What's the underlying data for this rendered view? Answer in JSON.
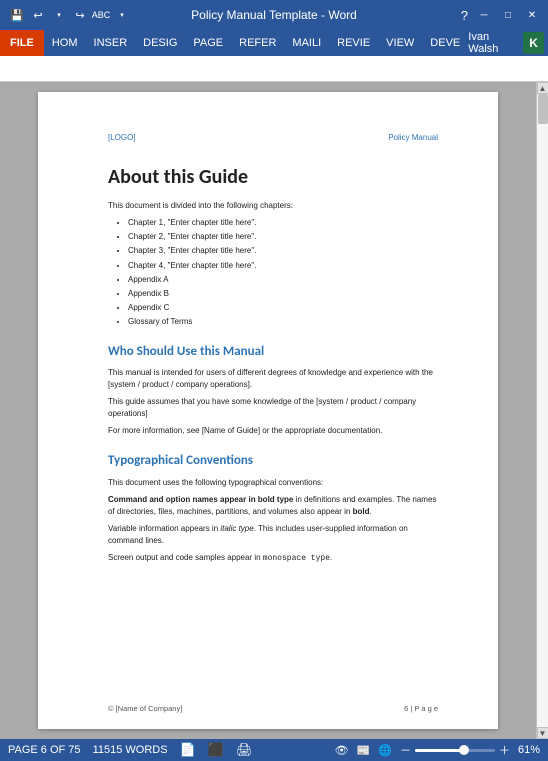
{
  "titlebar": {
    "title": "Policy Manual Template - Word",
    "app": "Word",
    "help": "?",
    "buttons": {
      "minimize": "─",
      "maximize": "□",
      "close": "✕"
    }
  },
  "qat": {
    "icons": [
      "💾",
      "↩",
      "↪",
      "ABC"
    ]
  },
  "ribbon": {
    "tabs": [
      "FILE",
      "HOM",
      "INSER",
      "DESIG",
      "PAGE",
      "REFER",
      "MAILI",
      "REVIE",
      "VIEW",
      "DEVE"
    ],
    "active_tab": "FILE",
    "user_name": "Ivan Walsh",
    "user_initial": "K"
  },
  "page": {
    "header": {
      "logo": "[LOGO]",
      "title": "Policy Manual"
    },
    "h1": "About this Guide",
    "intro": "This document is divided into the following chapters:",
    "bullets": [
      "Chapter 1, \"Enter chapter title here\".",
      "Chapter 2, \"Enter chapter title here\".",
      "Chapter 3, \"Enter chapter title here\".",
      "Chapter 4, \"Enter chapter title here\".",
      "Appendix A",
      "Appendix B",
      "Appendix C",
      "Glossary of Terms"
    ],
    "section1": {
      "heading": "Who Should Use this Manual",
      "paragraphs": [
        "This manual is intended for users of different degrees of knowledge and experience with the [system / product / company operations].",
        "This guide assumes that you have some knowledge of the [system / product / company operations]",
        "For more information, see [Name of Guide] or the appropriate documentation."
      ]
    },
    "section2": {
      "heading": "Typographical Conventions",
      "intro": "This document uses the following typographical conventions:",
      "paragraphs": [
        "Command and option names appear in bold type in definitions and examples. The names of directories, files, machines, partitions, and volumes also appear in bold.",
        "Variable information appears in italic type. This includes user-supplied information on command lines.",
        "Screen output and code samples appear in monospace type."
      ]
    },
    "footer": {
      "left": "© [Name of Company]",
      "right": "6 | P a g e"
    }
  },
  "statusbar": {
    "page_info": "PAGE 6 OF 75",
    "words": "11515 WORDS",
    "zoom_percent": "61%",
    "zoom_value": 61
  }
}
